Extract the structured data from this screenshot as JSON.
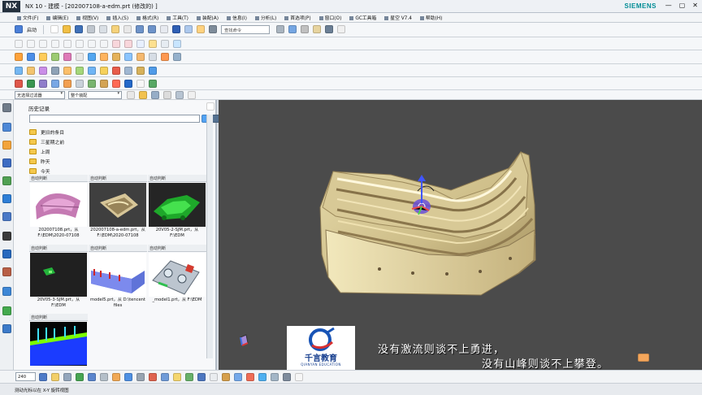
{
  "window": {
    "logo": "NX",
    "title": "NX 10 - 建模 - [202007108-a-edm.prt  (修改的)  ]",
    "brand": "SIEMENS",
    "controls": [
      "—",
      "▢",
      "✕"
    ]
  },
  "menu": [
    "文件(F)",
    "编辑(E)",
    "视图(V)",
    "插入(S)",
    "格式(R)",
    "工具(T)",
    "装配(A)",
    "信息(I)",
    "分析(L)",
    "首选项(P)",
    "窗口(O)",
    "GC工具箱",
    "星空 V7.4",
    "帮助(H)"
  ],
  "toolbar": {
    "start_label": "启动",
    "find_placeholder": "查找命令",
    "filter_value": "无选择过滤器",
    "assembly_value": "整个装配"
  },
  "navigator": {
    "title": "历史记录",
    "folders": [
      "更旧的条目",
      "三星期之前",
      "上周",
      "昨天",
      "今天"
    ],
    "cards": [
      {
        "head": "自动判断",
        "caption": "202007108.prt，从 F:\\EDM\\2020-07108",
        "thumb_bg": "#ffffff"
      },
      {
        "head": "自动判断",
        "caption": "202007108-a-edm.prt，从 F:\\EDM\\2020-07108",
        "thumb_bg": "#3f3f3f"
      },
      {
        "head": "自动判断",
        "caption": "20V05-2-SJM.prt，从 F:\\EDM",
        "thumb_bg": "#252525"
      },
      {
        "head": "自动判断",
        "caption": "20V05-3-SJM.prt，从 F:\\EDM",
        "thumb_bg": "#202020"
      },
      {
        "head": "自动判断",
        "caption": "model5.prt，从 D:\\tencent files",
        "thumb_bg": "#ffffff"
      },
      {
        "head": "自动判断",
        "caption": "_model1.prt，从 F:\\EDM",
        "thumb_bg": "#ffffff"
      },
      {
        "head": "自动判断",
        "caption": "",
        "thumb_bg": "#050505"
      }
    ]
  },
  "viewport": {
    "subtitle_line1": "没有激流则谈不上勇进，",
    "subtitle_line2": "没有山峰则谈不上攀登。",
    "logo_name": "千言教育",
    "logo_english": "QIANYAN EDUCATION"
  },
  "bottom": {
    "zoom": "240"
  },
  "status": {
    "text": "测动光标以在 X-Y 旋转视图"
  },
  "colors": {
    "viewport_bg": "#4b4b4b",
    "part_tan": "#cfc08d",
    "part_shadow": "#8f7d4e",
    "toolbar_bg": "#f5f7f9"
  }
}
